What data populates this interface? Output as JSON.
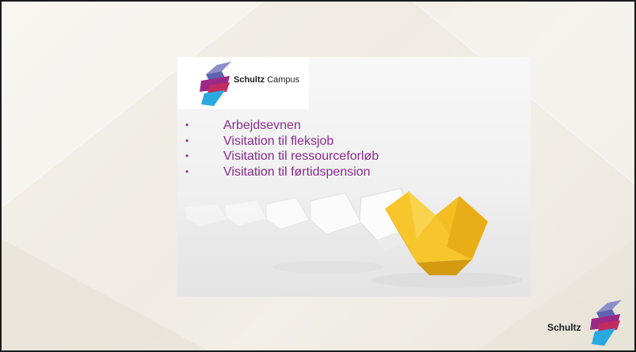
{
  "logo": {
    "brand_bold": "Schultz",
    "brand_light": "Campus"
  },
  "bullets": [
    {
      "label": "Arbejdsevnen"
    },
    {
      "label": "Visitation til fleksjob"
    },
    {
      "label": "Visitation til ressourceforløb"
    },
    {
      "label": "Visitation til førtidspension"
    }
  ],
  "footer": {
    "brand": "Schultz"
  },
  "colors": {
    "accent_text": "#8b2a8f",
    "bullet": "#8b2a8f",
    "slide_border": "#1a1a1a"
  },
  "icons": {
    "brand_mark": "schultz-logo-icon",
    "bullet": "bullet-dot-icon"
  }
}
